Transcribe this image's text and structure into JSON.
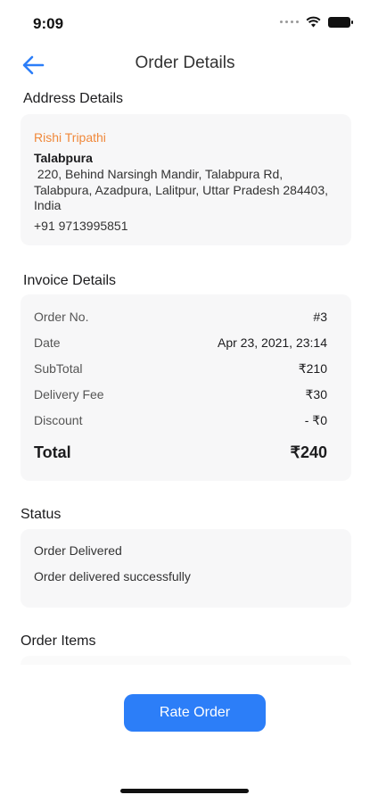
{
  "status_bar": {
    "time": "9:09"
  },
  "nav": {
    "title": "Order Details"
  },
  "address": {
    "section_title": "Address Details",
    "name": "Rishi Tripathi",
    "area": "Talabpura",
    "line": " 220, Behind Narsingh Mandir, Talabpura Rd, Talabpura, Azadpura, Lalitpur, Uttar Pradesh 284403, India",
    "phone": "+91 9713995851"
  },
  "invoice": {
    "section_title": "Invoice Details",
    "rows": [
      {
        "label": "Order No.",
        "value": "#3"
      },
      {
        "label": "Date",
        "value": "Apr 23, 2021, 23:14"
      },
      {
        "label": "SubTotal",
        "value": "₹210"
      },
      {
        "label": "Delivery Fee",
        "value": "₹30"
      },
      {
        "label": "Discount",
        "value": "- ₹0"
      }
    ],
    "total_label": "Total",
    "total_value": "₹240"
  },
  "status": {
    "section_title": "Status",
    "line1": "Order Delivered",
    "line2": "Order delivered successfully"
  },
  "order_items": {
    "section_title": "Order Items"
  },
  "actions": {
    "rate_label": "Rate Order"
  },
  "colors": {
    "accent": "#2c7ef8",
    "name": "#f0883a",
    "card": "#f7f7f8"
  },
  "icons": {
    "back": "arrow-left-icon",
    "wifi": "wifi-icon",
    "battery": "battery-icon"
  }
}
